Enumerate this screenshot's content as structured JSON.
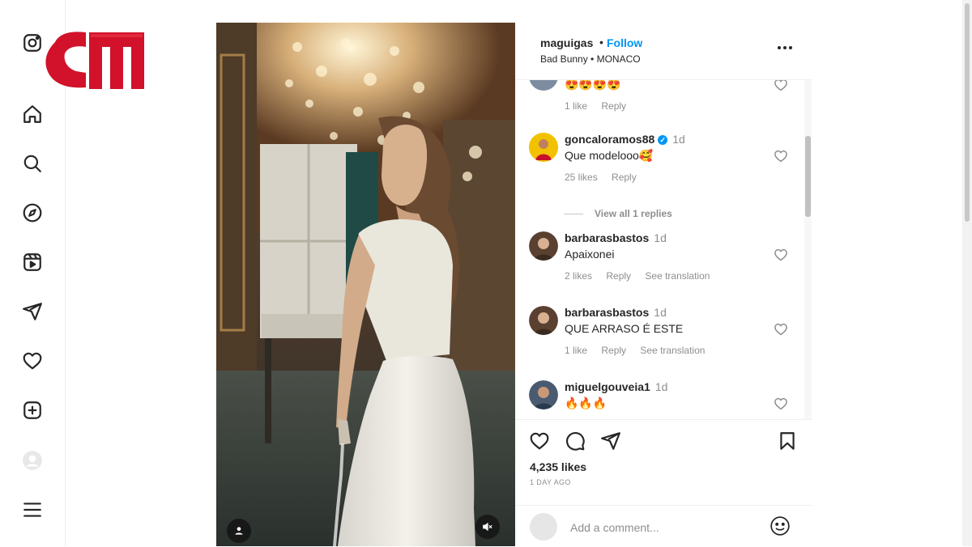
{
  "brand": {
    "logo_text": "cm",
    "logo_color": "#d1122a"
  },
  "sidebar": {
    "items": [
      {
        "name": "instagram-icon"
      },
      {
        "name": "home-icon"
      },
      {
        "name": "search-icon"
      },
      {
        "name": "explore-icon"
      },
      {
        "name": "reels-icon"
      },
      {
        "name": "messages-icon"
      },
      {
        "name": "notifications-icon"
      },
      {
        "name": "create-icon"
      },
      {
        "name": "profile-icon"
      },
      {
        "name": "menu-icon"
      }
    ]
  },
  "post": {
    "username": "maguigas",
    "separator": "•",
    "follow_label": "Follow",
    "audio": "Bad Bunny",
    "location": "MONACO",
    "subline": "Bad Bunny • MONACO",
    "likes": "4,235 likes",
    "time": "1 DAY AGO"
  },
  "comments": [
    {
      "username": "",
      "age": "",
      "text": "😍😍😍😍",
      "likes": "1 like",
      "reply": "Reply",
      "translation": ""
    },
    {
      "username": "goncaloramos88",
      "verified": true,
      "age": "1d",
      "text": "Que modelooo🥰",
      "likes": "25 likes",
      "reply": "Reply",
      "translation": ""
    },
    {
      "username": "barbarasbastos",
      "age": "1d",
      "text": "Apaixonei",
      "likes": "2 likes",
      "reply": "Reply",
      "translation": "See translation"
    },
    {
      "username": "barbarasbastos",
      "age": "1d",
      "text": "QUE ARRASO É ESTE",
      "likes": "1 like",
      "reply": "Reply",
      "translation": "See translation"
    },
    {
      "username": "miguelgouveia1",
      "age": "1d",
      "text": "🔥🔥🔥",
      "likes": "",
      "reply": "",
      "translation": ""
    }
  ],
  "view_replies": "View all 1 replies",
  "add_comment": {
    "placeholder": "Add a comment..."
  },
  "colors": {
    "link_blue": "#0095f6",
    "text": "#262626",
    "muted": "#8e8e8e"
  }
}
